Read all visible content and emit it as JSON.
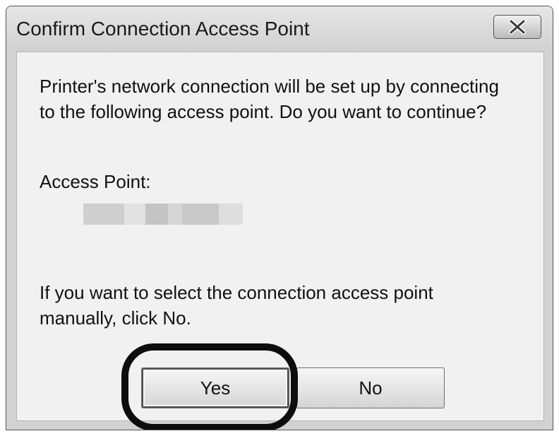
{
  "dialog": {
    "title": "Confirm Connection Access Point",
    "close_icon": "close-x-icon",
    "message_lines": [
      "Printer's network connection will be set up by connecting",
      "to the following access point. Do you want to continue?"
    ],
    "access_point_label": "Access Point:",
    "access_point_value": "",
    "note_lines": [
      "If you want to select the connection access point",
      "manually, click No."
    ],
    "buttons": {
      "yes": "Yes",
      "no": "No"
    }
  },
  "colors": {
    "window_frame": "#d2d2d2",
    "client_area": "#f1f1f1",
    "highlight_ring": "#0d0d0d"
  }
}
